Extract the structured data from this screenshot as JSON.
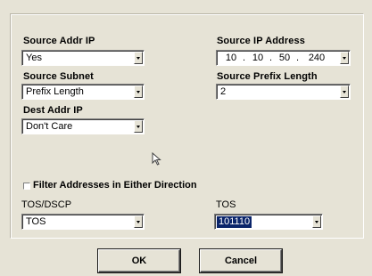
{
  "source_addr_ip": {
    "label": "Source Addr IP",
    "value": "Yes"
  },
  "source_ip_address": {
    "label": "Source IP Address",
    "octets": [
      "10",
      "10",
      "50",
      "240"
    ]
  },
  "source_subnet": {
    "label": "Source Subnet",
    "value": "Prefix Length"
  },
  "source_prefix_length": {
    "label": "Source Prefix Length",
    "value": "2"
  },
  "dest_addr_ip": {
    "label": "Dest Addr IP",
    "value": "Don't Care"
  },
  "filter_both": {
    "label": "Filter Addresses in Either Direction",
    "checked": false
  },
  "tos_dscp": {
    "label": "TOS/DSCP",
    "value": "TOS"
  },
  "tos": {
    "label": "TOS",
    "value": "101110"
  },
  "buttons": {
    "ok": "OK",
    "cancel": "Cancel"
  },
  "icons": {
    "cursor": "mouse-pointer-icon",
    "dropdown": "chevron-down-icon"
  },
  "colors": {
    "background": "#e6e3d6",
    "selection": "#0a246a"
  }
}
